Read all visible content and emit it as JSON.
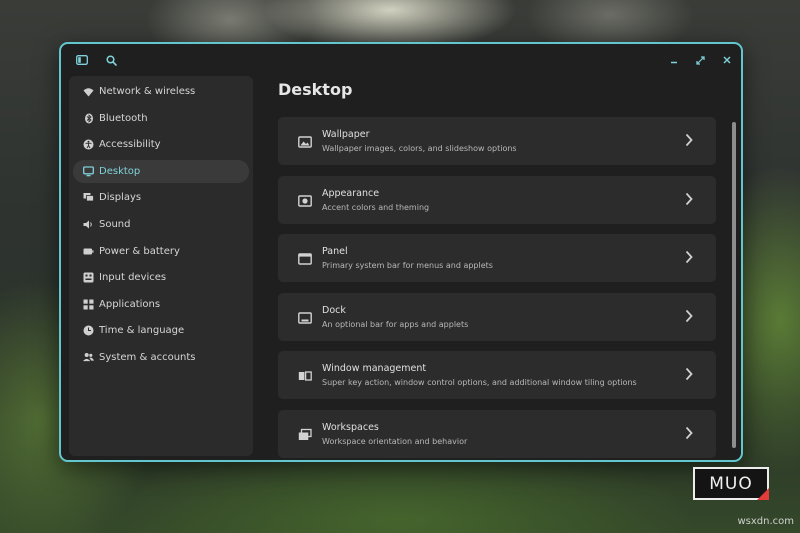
{
  "window": {
    "titlebar": {
      "sidebar_toggle_icon": "sidebar-panel-icon",
      "search_icon": "search-icon",
      "minimize_icon": "minimize-icon",
      "maximize_icon": "maximize-icon",
      "close_icon": "close-icon"
    },
    "accent_color": "#63c6cf"
  },
  "sidebar": {
    "items": [
      {
        "label": "Network & wireless",
        "icon": "wifi-icon",
        "active": false
      },
      {
        "label": "Bluetooth",
        "icon": "bluetooth-icon",
        "active": false
      },
      {
        "label": "Accessibility",
        "icon": "accessibility-icon",
        "active": false
      },
      {
        "label": "Desktop",
        "icon": "monitor-icon",
        "active": true
      },
      {
        "label": "Displays",
        "icon": "displays-icon",
        "active": false
      },
      {
        "label": "Sound",
        "icon": "speaker-icon",
        "active": false
      },
      {
        "label": "Power & battery",
        "icon": "battery-icon",
        "active": false
      },
      {
        "label": "Input devices",
        "icon": "keyboard-icon",
        "active": false
      },
      {
        "label": "Applications",
        "icon": "apps-grid-icon",
        "active": false
      },
      {
        "label": "Time & language",
        "icon": "clock-icon",
        "active": false
      },
      {
        "label": "System & accounts",
        "icon": "users-icon",
        "active": false
      }
    ]
  },
  "main": {
    "title": "Desktop",
    "cards": [
      {
        "title": "Wallpaper",
        "subtitle": "Wallpaper images, colors, and slideshow options",
        "icon": "image-icon"
      },
      {
        "title": "Appearance",
        "subtitle": "Accent colors and theming",
        "icon": "appearance-icon"
      },
      {
        "title": "Panel",
        "subtitle": "Primary system bar for menus and applets",
        "icon": "panel-icon"
      },
      {
        "title": "Dock",
        "subtitle": "An optional bar for apps and applets",
        "icon": "dock-icon"
      },
      {
        "title": "Window management",
        "subtitle": "Super key action, window control options, and additional window tiling options",
        "icon": "window-tiling-icon"
      },
      {
        "title": "Workspaces",
        "subtitle": "Workspace orientation and behavior",
        "icon": "workspaces-icon"
      }
    ]
  },
  "brand": {
    "text": "MUO"
  },
  "watermark": {
    "text": "wsxdn.com"
  }
}
